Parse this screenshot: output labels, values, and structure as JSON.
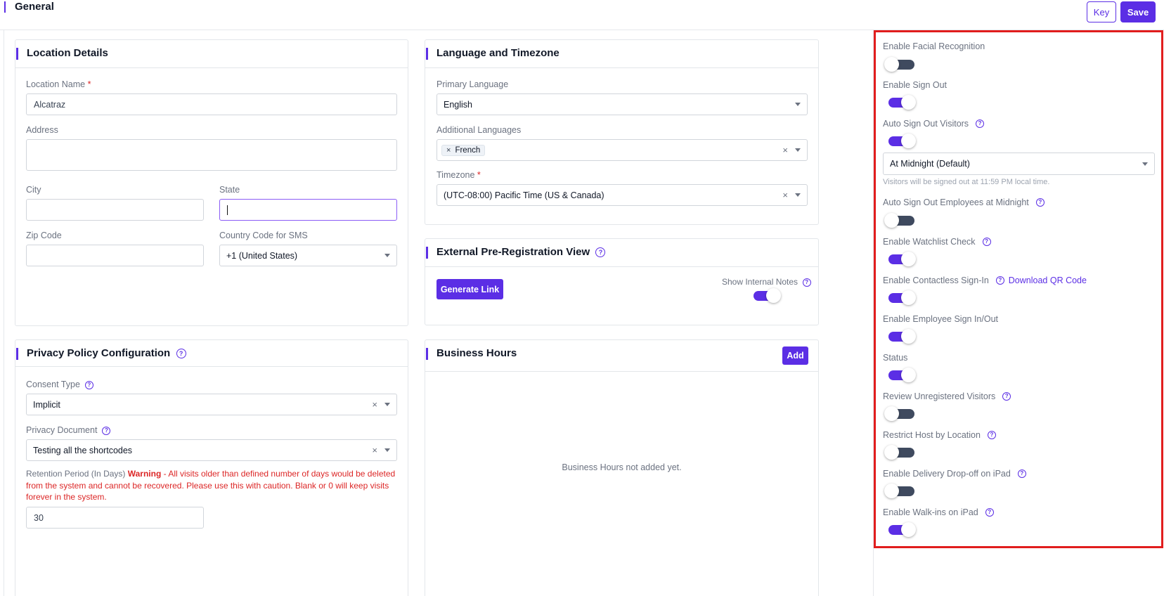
{
  "page": {
    "title": "General"
  },
  "header": {
    "key_label": "Key",
    "save_label": "Save"
  },
  "location": {
    "title": "Location Details",
    "name_label": "Location Name",
    "name_value": "Alcatraz",
    "address_label": "Address",
    "city_label": "City",
    "state_label": "State",
    "zip_label": "Zip Code",
    "country_label": "Country Code for SMS",
    "country_value": "+1 (United States)",
    "required_mark": "*"
  },
  "language": {
    "title": "Language and Timezone",
    "primary_label": "Primary Language",
    "primary_value": "English",
    "additional_label": "Additional Languages",
    "additional_chips": [
      "French"
    ],
    "chip_remove": "×",
    "timezone_label": "Timezone",
    "timezone_value": "(UTC-08:00) Pacific Time (US & Canada)",
    "clear": "×"
  },
  "prereg": {
    "title": "External Pre-Registration View",
    "generate_label": "Generate Link",
    "show_notes_label": "Show Internal Notes",
    "show_notes_on": true
  },
  "privacy": {
    "title": "Privacy Policy Configuration",
    "consent_label": "Consent Type",
    "consent_value": "Implicit",
    "document_label": "Privacy Document",
    "document_value": "Testing all the shortcodes",
    "retention_label": "Retention Period (In Days)",
    "warning_bold": "Warning",
    "warning_text": " - All visits older than defined number of days would be deleted from the system and cannot be recovered. Please use this with caution. Blank or 0 will keep visits forever in the system.",
    "retention_value": "30",
    "clear": "×"
  },
  "business_hours": {
    "title": "Business Hours",
    "add_label": "Add",
    "empty_message": "Business Hours not added yet."
  },
  "settings": {
    "help_glyph": "?",
    "auto_signout_option": "At Midnight (Default)",
    "auto_signout_helper": "Visitors will be signed out at 11:59 PM local time.",
    "download_qr_label": "Download QR Code",
    "toggles": [
      {
        "label": "Enable Facial Recognition",
        "on": false
      },
      {
        "label": "Enable Sign Out",
        "on": true
      },
      {
        "label": "Auto Sign Out Visitors",
        "on": true
      },
      {
        "label": "Auto Sign Out Employees at Midnight",
        "on": false
      },
      {
        "label": "Enable Watchlist Check",
        "on": true
      },
      {
        "label": "Enable Contactless Sign-In",
        "on": true
      },
      {
        "label": "Enable Employee Sign In/Out",
        "on": true
      },
      {
        "label": "Status",
        "on": true
      },
      {
        "label": "Review Unregistered Visitors",
        "on": false
      },
      {
        "label": "Restrict Host by Location",
        "on": false
      },
      {
        "label": "Enable Delivery Drop-off on iPad",
        "on": false
      },
      {
        "label": "Enable Walk-ins on iPad",
        "on": true
      }
    ]
  }
}
